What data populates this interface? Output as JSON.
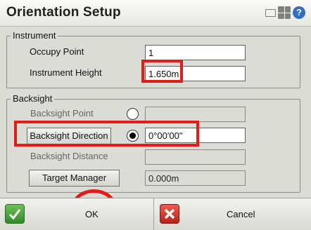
{
  "window": {
    "title": "Orientation Setup"
  },
  "header_icons": [
    "keyboard-icon",
    "grid-icon",
    "help-icon"
  ],
  "instrument": {
    "legend": "Instrument",
    "occupy_point_label": "Occupy Point",
    "occupy_point_value": "1",
    "instrument_height_label": "Instrument Height",
    "instrument_height_value": "1.650m"
  },
  "backsight": {
    "legend": "Backsight",
    "backsight_point_label": "Backsight Point",
    "backsight_point_value": "",
    "backsight_direction_label": "Backsight Direction",
    "backsight_direction_value": "0°00'00\"",
    "backsight_distance_label": "Backsight Distance",
    "backsight_distance_value": "",
    "target_manager_label": "Target Manager",
    "target_value": "0.000m",
    "selected_option": "Backsight Direction"
  },
  "footer": {
    "ok_label": "OK",
    "cancel_label": "Cancel"
  },
  "colors": {
    "highlight": "#e31b1b",
    "background": "#dcdcd6"
  }
}
